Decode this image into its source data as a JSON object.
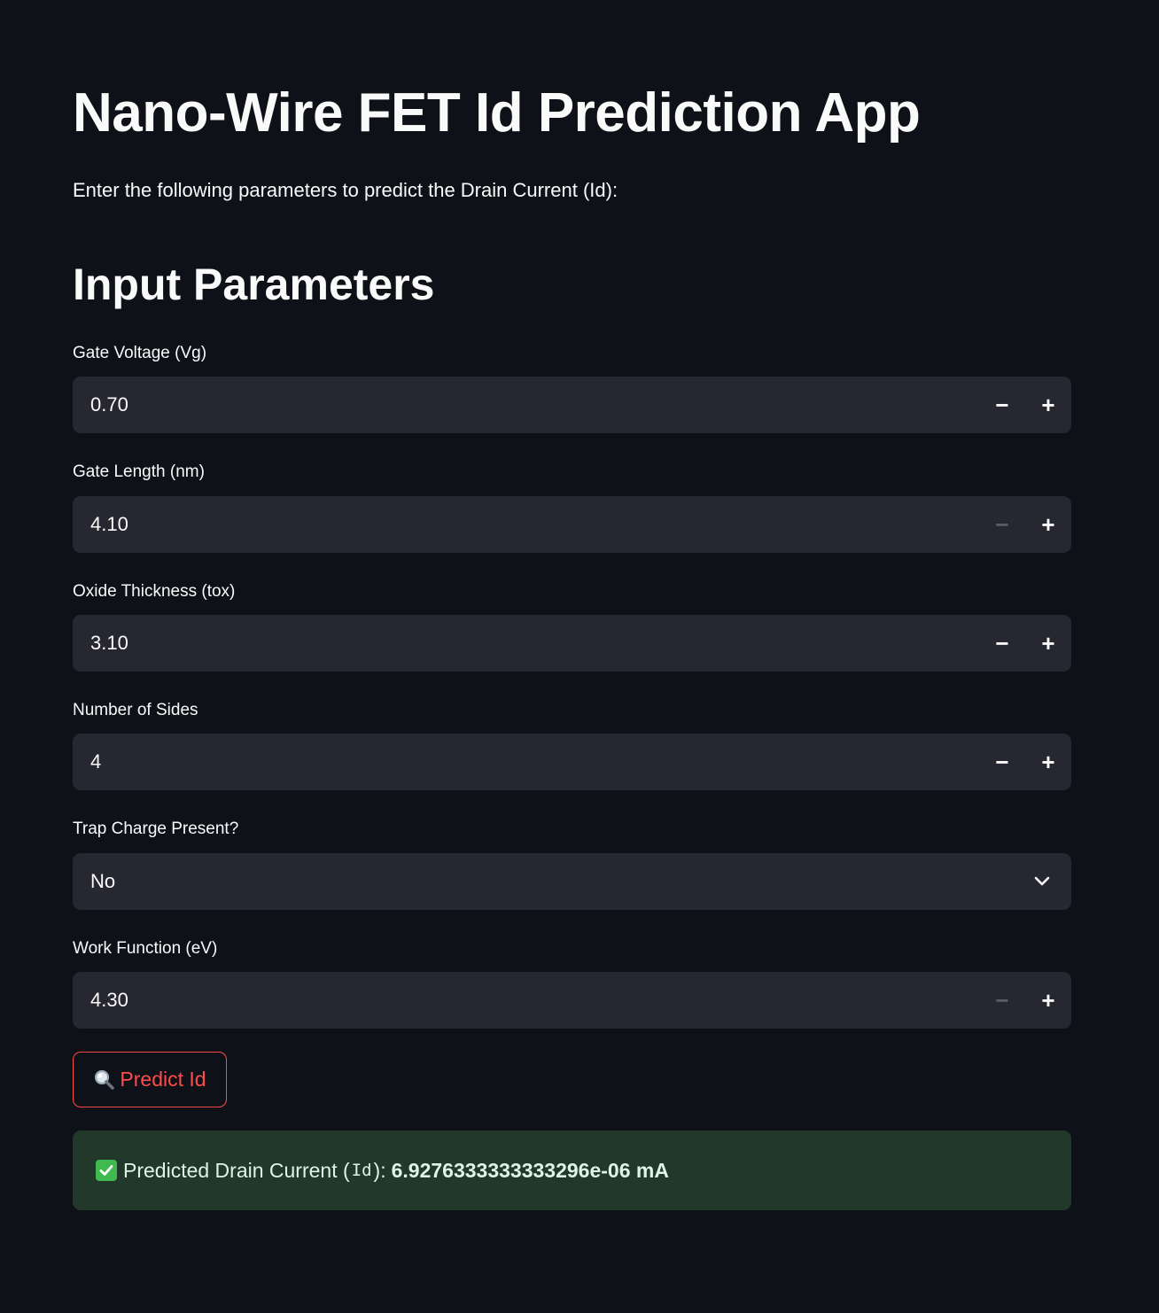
{
  "app": {
    "title": "Nano-Wire FET Id Prediction App",
    "subtitle": "Enter the following parameters to predict the Drain Current (Id):"
  },
  "section": {
    "heading": "Input Parameters"
  },
  "fields": {
    "gate_voltage": {
      "label": "Gate Voltage (Vg)",
      "value": "0.70"
    },
    "gate_length": {
      "label": "Gate Length (nm)",
      "value": "4.10"
    },
    "oxide_thickness": {
      "label": "Oxide Thickness (tox)",
      "value": "3.10"
    },
    "number_of_sides": {
      "label": "Number of Sides",
      "value": "4"
    },
    "trap_charge": {
      "label": "Trap Charge Present?",
      "value": "No"
    },
    "work_function": {
      "label": "Work Function (eV)",
      "value": "4.30"
    }
  },
  "stepper": {
    "minus": "−",
    "plus": "+"
  },
  "predict_button": {
    "label": "Predict Id",
    "icon": "magnifier-icon"
  },
  "result": {
    "icon": "check-icon",
    "prefix": "Predicted Drain Current (",
    "code": "Id",
    "suffix": "):",
    "value": "6.9276333333333296e-06 mA"
  },
  "colors": {
    "background": "#0e1117",
    "input_background": "#262730",
    "accent": "#ff4b4b",
    "success_background": "#21382a",
    "success_check": "#3fb950"
  }
}
